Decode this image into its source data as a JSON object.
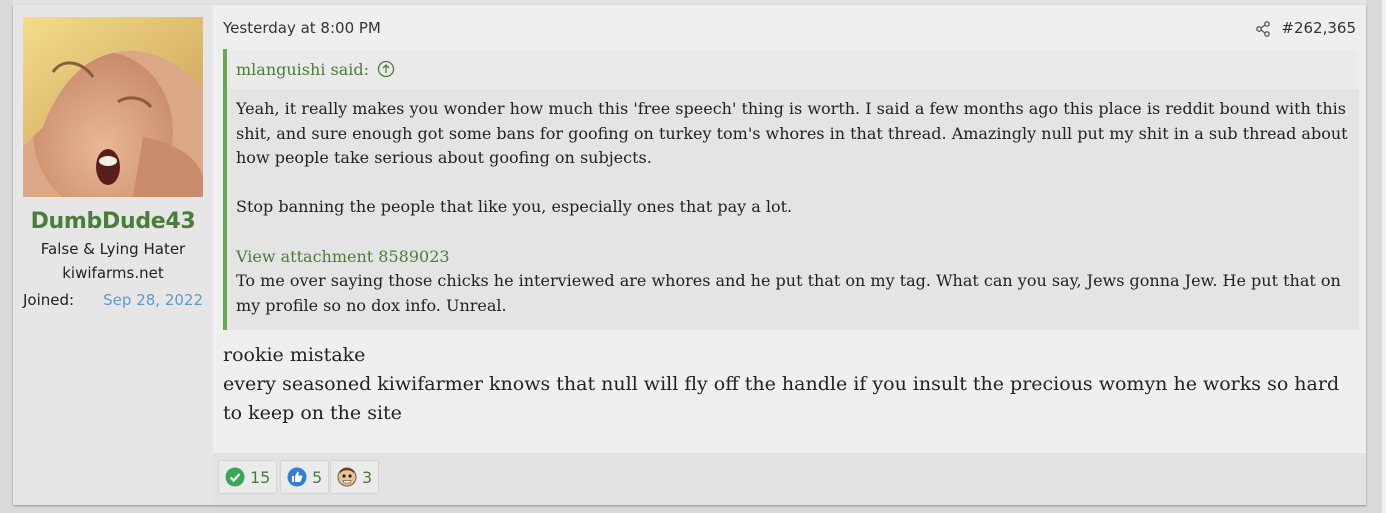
{
  "user": {
    "name": "DumbDude43",
    "titles": [
      "False & Lying Hater",
      "kiwifarms.net"
    ],
    "joined_label": "Joined:",
    "joined_value": "Sep 28, 2022"
  },
  "post": {
    "date": "Yesterday at 8:00 PM",
    "number": "#262,365",
    "quote": {
      "author": "mlanguishi said:",
      "paragraph1": "Yeah, it really makes you wonder how much this 'free speech' thing is worth. I said a few months ago this place is reddit bound with this shit, and sure enough got some bans for goofing on turkey tom's whores in that thread. Amazingly null put my shit in a sub thread about how people take serious about goofing on subjects.",
      "paragraph2": "Stop banning the people that like you, especially ones that pay a lot.",
      "attachment_link": "View attachment 8589023",
      "paragraph3": "To me over saying those chicks he interviewed are whores and he put that on my tag. What can you say, Jews gonna Jew. He put that on my profile so no dox info. Unreal."
    },
    "body_line1": "rookie mistake",
    "body_line2": "every seasoned kiwifarmer knows that null will fly off the handle if you insult the precious womyn he works so hard to keep on the site"
  },
  "reactions": [
    {
      "icon": "checkmark-icon",
      "count": "15",
      "color": "#3aa65a"
    },
    {
      "icon": "thumbs-up-icon",
      "count": "5",
      "color": "#2f7fd8"
    },
    {
      "icon": "face-icon",
      "count": "3",
      "color": "#b98a5e"
    }
  ],
  "colors": {
    "accent_green": "#4a7c3a",
    "quote_border": "#6aa84f",
    "link_blue": "#5a9ad0"
  }
}
